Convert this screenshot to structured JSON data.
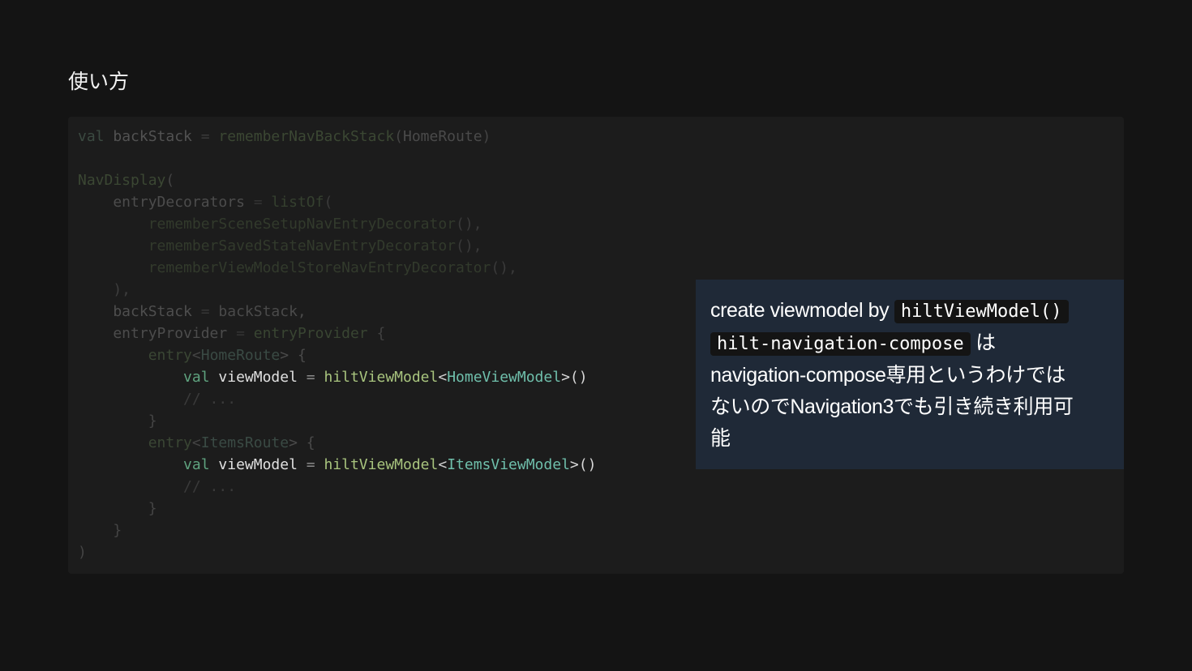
{
  "slide": {
    "title": "使い方"
  },
  "code_panel": {
    "lines": [
      [
        {
          "t": "val",
          "c": "#3b4a41"
        },
        {
          "t": " backStack ",
          "c": "#525252"
        },
        {
          "t": "=",
          "c": "#3a3a3a"
        },
        {
          "t": " rememberNavBackStack",
          "c": "#3b4733"
        },
        {
          "t": "(",
          "c": "#444444"
        },
        {
          "t": "HomeRoute",
          "c": "#4a4a4a"
        },
        {
          "t": ")",
          "c": "#444444"
        }
      ],
      [],
      [
        {
          "t": "NavDisplay",
          "c": "#3b4733"
        },
        {
          "t": "(",
          "c": "#444444"
        }
      ],
      [
        {
          "t": "    entryDecorators ",
          "c": "#4c4c4c"
        },
        {
          "t": "=",
          "c": "#333333"
        },
        {
          "t": " listOf",
          "c": "#35402f"
        },
        {
          "t": "(",
          "c": "#3a3a3a"
        }
      ],
      [
        {
          "t": "        rememberSceneSetupNavEntryDecorator",
          "c": "#323a2c"
        },
        {
          "t": "(),",
          "c": "#3a3a3a"
        }
      ],
      [
        {
          "t": "        rememberSavedStateNavEntryDecorator",
          "c": "#323a2c"
        },
        {
          "t": "(),",
          "c": "#3a3a3a"
        }
      ],
      [
        {
          "t": "        rememberViewModelStoreNavEntryDecorator",
          "c": "#323a2c"
        },
        {
          "t": "(),",
          "c": "#3a3a3a"
        }
      ],
      [
        {
          "t": "    ),",
          "c": "#3e3e3e"
        }
      ],
      [
        {
          "t": "    backStack ",
          "c": "#4e4e4e"
        },
        {
          "t": "=",
          "c": "#363636"
        },
        {
          "t": " backStack,",
          "c": "#4a4a4a"
        }
      ],
      [
        {
          "t": "    entryProvider ",
          "c": "#4c4c4c"
        },
        {
          "t": "=",
          "c": "#333333"
        },
        {
          "t": " entryProvider",
          "c": "#394532"
        },
        {
          "t": " {",
          "c": "#414141"
        }
      ],
      [
        {
          "t": "        entry",
          "c": "#3a4634"
        },
        {
          "t": "<",
          "c": "#444444"
        },
        {
          "t": "HomeRoute",
          "c": "#3a4a44"
        },
        {
          "t": "> {",
          "c": "#4a4a4a"
        }
      ],
      [
        {
          "t": "            val",
          "c": "#5fa37f"
        },
        {
          "t": " viewModel ",
          "c": "#e0e0e0"
        },
        {
          "t": "=",
          "c": "#8a8a8a"
        },
        {
          "t": " hiltViewModel",
          "c": "#a8c47e"
        },
        {
          "t": "<",
          "c": "#d0d0d0"
        },
        {
          "t": "HomeViewModel",
          "c": "#6fbfab"
        },
        {
          "t": ">()",
          "c": "#d8d8d8"
        }
      ],
      [
        {
          "t": "            // ...",
          "c": "#3a3a3a"
        }
      ],
      [
        {
          "t": "        }",
          "c": "#444444"
        }
      ],
      [
        {
          "t": "        entry",
          "c": "#3a4634"
        },
        {
          "t": "<",
          "c": "#444444"
        },
        {
          "t": "ItemsRoute",
          "c": "#3a4a44"
        },
        {
          "t": "> {",
          "c": "#4a4a4a"
        }
      ],
      [
        {
          "t": "            val",
          "c": "#5fa37f"
        },
        {
          "t": " viewModel ",
          "c": "#e0e0e0"
        },
        {
          "t": "=",
          "c": "#8a8a8a"
        },
        {
          "t": " hiltViewModel",
          "c": "#a8c47e"
        },
        {
          "t": "<",
          "c": "#d0d0d0"
        },
        {
          "t": "ItemsViewModel",
          "c": "#6fbfab"
        },
        {
          "t": ">()",
          "c": "#d8d8d8"
        }
      ],
      [
        {
          "t": "            // ...",
          "c": "#3a3a3a"
        }
      ],
      [
        {
          "t": "        }",
          "c": "#444444"
        }
      ],
      [
        {
          "t": "    }",
          "c": "#444444"
        }
      ],
      [
        {
          "t": ")",
          "c": "#444444"
        }
      ]
    ]
  },
  "callout": {
    "line1_text": "create viewmodel by ",
    "line1_code": "hiltViewModel()",
    "line2_code": "hilt-navigation-compose",
    "line2_text": " は",
    "line3_text": "navigation-compose専用というわけでは",
    "line4_text": "ないのでNavigation3でも引き続き利用可",
    "line5_text": "能"
  },
  "colors": {
    "background": "#141414",
    "code_panel": "#1c1c1c",
    "callout_bg": "#1f2937",
    "inline_code_bg": "#141414"
  }
}
